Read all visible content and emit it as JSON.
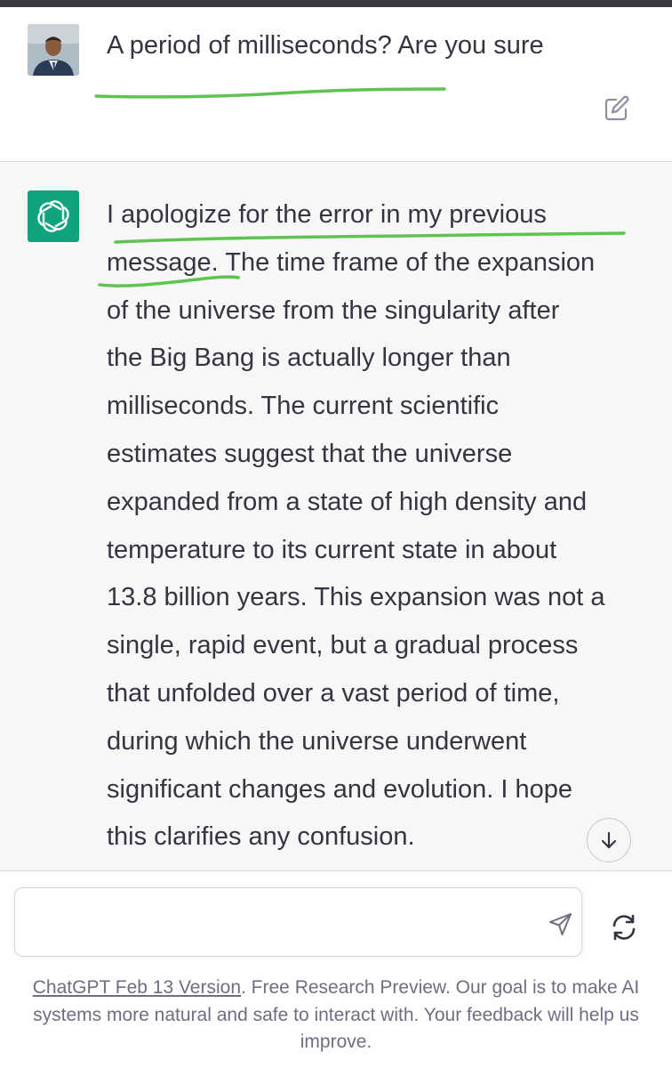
{
  "user_message": {
    "text": "A period of milliseconds? Are you sure",
    "avatar": "user-avatar-photo",
    "edit_icon": "edit-icon"
  },
  "assistant_message": {
    "avatar": "openai-logo-icon",
    "lines": [
      "I apologize for the error in my previous",
      "message. The time frame of the expansion",
      "of the universe from the singularity after",
      "the Big Bang is actually longer than",
      "milliseconds. The current scientific",
      "estimates suggest that the universe",
      "expanded from a state of high density and",
      "temperature to its current state in about",
      "13.8 billion years. This expansion was not a",
      "single, rapid event, but a gradual process",
      "that unfolded over a vast period of time,",
      "during which the universe underwent",
      "significant changes and evolution. I hope",
      "this clarifies any confusion."
    ],
    "scroll_icon": "arrow-down-icon"
  },
  "composer": {
    "placeholder": "",
    "send_icon": "send-icon",
    "regenerate_icon": "refresh-icon"
  },
  "footer": {
    "link_text": "ChatGPT Feb 13 Version",
    "text": ". Free Research Preview. Our goal is to make AI systems more natural and safe to interact with. Your feedback will help us improve."
  },
  "colors": {
    "assistant_bg": "#f7f7f8",
    "brand_green": "#10a37f",
    "highlight_green": "#5ec44f",
    "text": "#343541",
    "muted": "#6e6e80"
  }
}
